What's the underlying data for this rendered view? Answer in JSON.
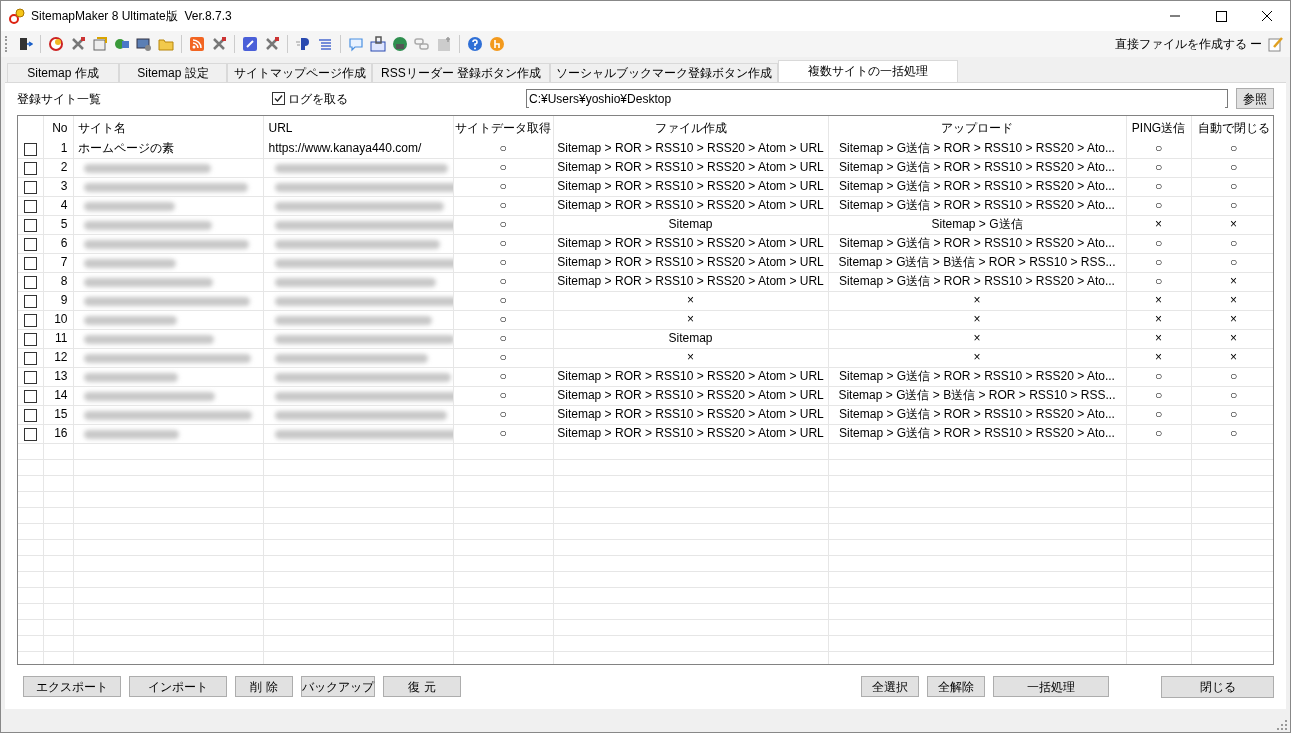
{
  "window": {
    "title": "SitemapMaker 8 Ultimate版  Ver.8.7.3"
  },
  "toolbar": {
    "direct_label": "直接ファイルを作成する ー"
  },
  "tabs": [
    {
      "label": "Sitemap 作成",
      "selected": false
    },
    {
      "label": "Sitemap 設定",
      "selected": false
    },
    {
      "label": "サイトマップページ作成",
      "selected": false
    },
    {
      "label": "RSSリーダー 登録ボタン作成",
      "selected": false
    },
    {
      "label": "ソーシャルブックマーク登録ボタン作成",
      "selected": false
    },
    {
      "label": "複数サイトの一括処理",
      "selected": true
    }
  ],
  "list_label": "登録サイト一覧",
  "log_option": {
    "label": "ログを取る",
    "checked": true
  },
  "path_field": {
    "value": "C:¥Users¥yoshio¥Desktop"
  },
  "browse_button": "参照",
  "table": {
    "columns": [
      "No",
      "サイト名",
      "URL",
      "サイトデータ取得",
      "ファイル作成",
      "アップロード",
      "PING送信",
      "自動で閉じる"
    ],
    "rows": [
      {
        "checked": false,
        "no": "1",
        "redacted": false,
        "name": "ホームページの素",
        "url": "https://www.kanaya440.com/",
        "data": "○",
        "file": "Sitemap > ROR > RSS10 > RSS20 > Atom > URL",
        "upload": "Sitemap > G送信 > ROR > RSS10 > RSS20 > Ato...",
        "ping": "○",
        "auto_close": "○"
      },
      {
        "checked": false,
        "no": "2",
        "redacted": true,
        "data": "○",
        "file": "Sitemap > ROR > RSS10 > RSS20 > Atom > URL",
        "upload": "Sitemap > G送信 > ROR > RSS10 > RSS20 > Ato...",
        "ping": "○",
        "auto_close": "○"
      },
      {
        "checked": false,
        "no": "3",
        "redacted": true,
        "data": "○",
        "file": "Sitemap > ROR > RSS10 > RSS20 > Atom > URL",
        "upload": "Sitemap > G送信 > ROR > RSS10 > RSS20 > Ato...",
        "ping": "○",
        "auto_close": "○"
      },
      {
        "checked": false,
        "no": "4",
        "redacted": true,
        "data": "○",
        "file": "Sitemap > ROR > RSS10 > RSS20 > Atom > URL",
        "upload": "Sitemap > G送信 > ROR > RSS10 > RSS20 > Ato...",
        "ping": "○",
        "auto_close": "○"
      },
      {
        "checked": false,
        "no": "5",
        "redacted": true,
        "data": "○",
        "file": "Sitemap",
        "upload": "Sitemap > G送信",
        "ping": "×",
        "auto_close": "×"
      },
      {
        "checked": false,
        "no": "6",
        "redacted": true,
        "data": "○",
        "file": "Sitemap > ROR > RSS10 > RSS20 > Atom > URL",
        "upload": "Sitemap > G送信 > ROR > RSS10 > RSS20 > Ato...",
        "ping": "○",
        "auto_close": "○"
      },
      {
        "checked": false,
        "no": "7",
        "redacted": true,
        "data": "○",
        "file": "Sitemap > ROR > RSS10 > RSS20 > Atom > URL",
        "upload": "Sitemap > G送信 > B送信 > ROR > RSS10 > RSS...",
        "ping": "○",
        "auto_close": "○"
      },
      {
        "checked": false,
        "no": "8",
        "redacted": true,
        "data": "○",
        "file": "Sitemap > ROR > RSS10 > RSS20 > Atom > URL",
        "upload": "Sitemap > G送信 > ROR > RSS10 > RSS20 > Ato...",
        "ping": "○",
        "auto_close": "×"
      },
      {
        "checked": false,
        "no": "9",
        "redacted": true,
        "data": "○",
        "file": "×",
        "upload": "×",
        "ping": "×",
        "auto_close": "×"
      },
      {
        "checked": false,
        "no": "10",
        "redacted": true,
        "data": "○",
        "file": "×",
        "upload": "×",
        "ping": "×",
        "auto_close": "×"
      },
      {
        "checked": false,
        "no": "11",
        "redacted": true,
        "data": "○",
        "file": "Sitemap",
        "upload": "×",
        "ping": "×",
        "auto_close": "×"
      },
      {
        "checked": false,
        "no": "12",
        "redacted": true,
        "data": "○",
        "file": "×",
        "upload": "×",
        "ping": "×",
        "auto_close": "×"
      },
      {
        "checked": false,
        "no": "13",
        "redacted": true,
        "data": "○",
        "file": "Sitemap > ROR > RSS10 > RSS20 > Atom > URL",
        "upload": "Sitemap > G送信 > ROR > RSS10 > RSS20 > Ato...",
        "ping": "○",
        "auto_close": "○"
      },
      {
        "checked": false,
        "no": "14",
        "redacted": true,
        "data": "○",
        "file": "Sitemap > ROR > RSS10 > RSS20 > Atom > URL",
        "upload": "Sitemap > G送信 > B送信 > ROR > RSS10 > RSS...",
        "ping": "○",
        "auto_close": "○"
      },
      {
        "checked": false,
        "no": "15",
        "redacted": true,
        "data": "○",
        "file": "Sitemap > ROR > RSS10 > RSS20 > Atom > URL",
        "upload": "Sitemap > G送信 > ROR > RSS10 > RSS20 > Ato...",
        "ping": "○",
        "auto_close": "○"
      },
      {
        "checked": false,
        "no": "16",
        "redacted": true,
        "data": "○",
        "file": "Sitemap > ROR > RSS10 > RSS20 > Atom > URL",
        "upload": "Sitemap > G送信 > ROR > RSS10 > RSS20 > Ato...",
        "ping": "○",
        "auto_close": "○"
      }
    ]
  },
  "left_buttons": [
    "エクスポート",
    "インポート",
    "削 除",
    "バックアップ",
    "復 元"
  ],
  "right_buttons": [
    "全選択",
    "全解除",
    "一括処理"
  ],
  "close_button": "閉じる"
}
